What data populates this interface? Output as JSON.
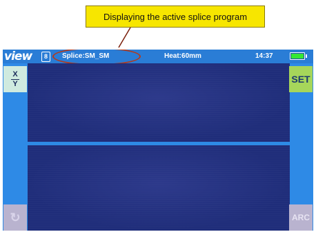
{
  "annotation": {
    "callout_text": "Displaying the active splice program"
  },
  "status_bar": {
    "logo_text": "view",
    "model_badge": "8",
    "splice_program": "Splice:SM_SM",
    "heat_program": "Heat:60mm",
    "time": "14:37",
    "battery_level": 1.0,
    "battery_color": "#35e835"
  },
  "buttons": {
    "xy_top": "X",
    "xy_bottom": "Y",
    "set_label": "SET",
    "reset_icon": "reset-arrow-icon",
    "reset_glyph": "↻",
    "arc_label": "ARC"
  },
  "colors": {
    "screen_bg": "#2e8ae6",
    "view_panel": "#1f2d7a",
    "highlight_ring": "#b33a1c",
    "callout_bg": "#f7e600",
    "set_button_bg": "#a6d65a",
    "xy_button_bg": "#cfeadf"
  }
}
